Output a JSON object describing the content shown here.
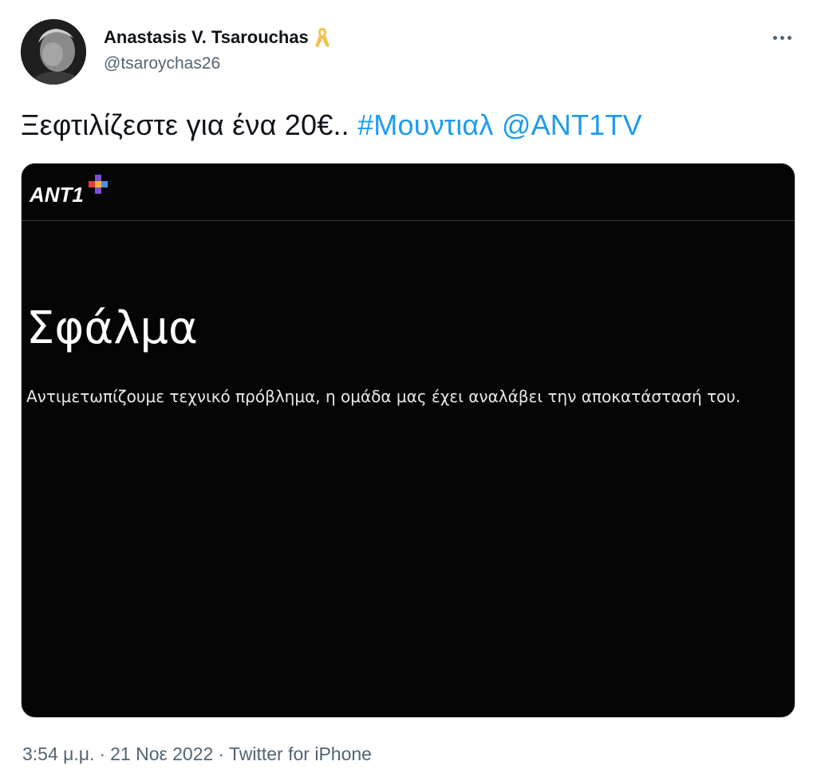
{
  "author": {
    "name": "Anastasis V. Tsarouchas",
    "handle": "@tsaroychas26",
    "avatar_icon": "user-avatar",
    "badge_icon": "ribbon-icon",
    "badge_color": "#f2c14e"
  },
  "menu": {
    "more_icon": "more-horizontal-icon"
  },
  "tweet": {
    "text": "Ξεφτιλίζεστε για ένα 20€..",
    "hashtag": "#Μουντιαλ",
    "mention": "@ANT1TV",
    "link_color": "#1d9bf0"
  },
  "media": {
    "logo_text": "ANT1",
    "logo_icon": "ant1-plus-logo",
    "error_title": "Σφάλμα",
    "error_message": "Αντιμετωπίζουμε τεχνικό πρόβλημα, η ομάδα μας έχει αναλάβει την αποκατάστασή του.",
    "background_color": "#050505"
  },
  "meta": {
    "time": "3:54 μ.μ.",
    "date": "21 Νοε 2022",
    "source": "Twitter for iPhone",
    "separator": "·"
  }
}
